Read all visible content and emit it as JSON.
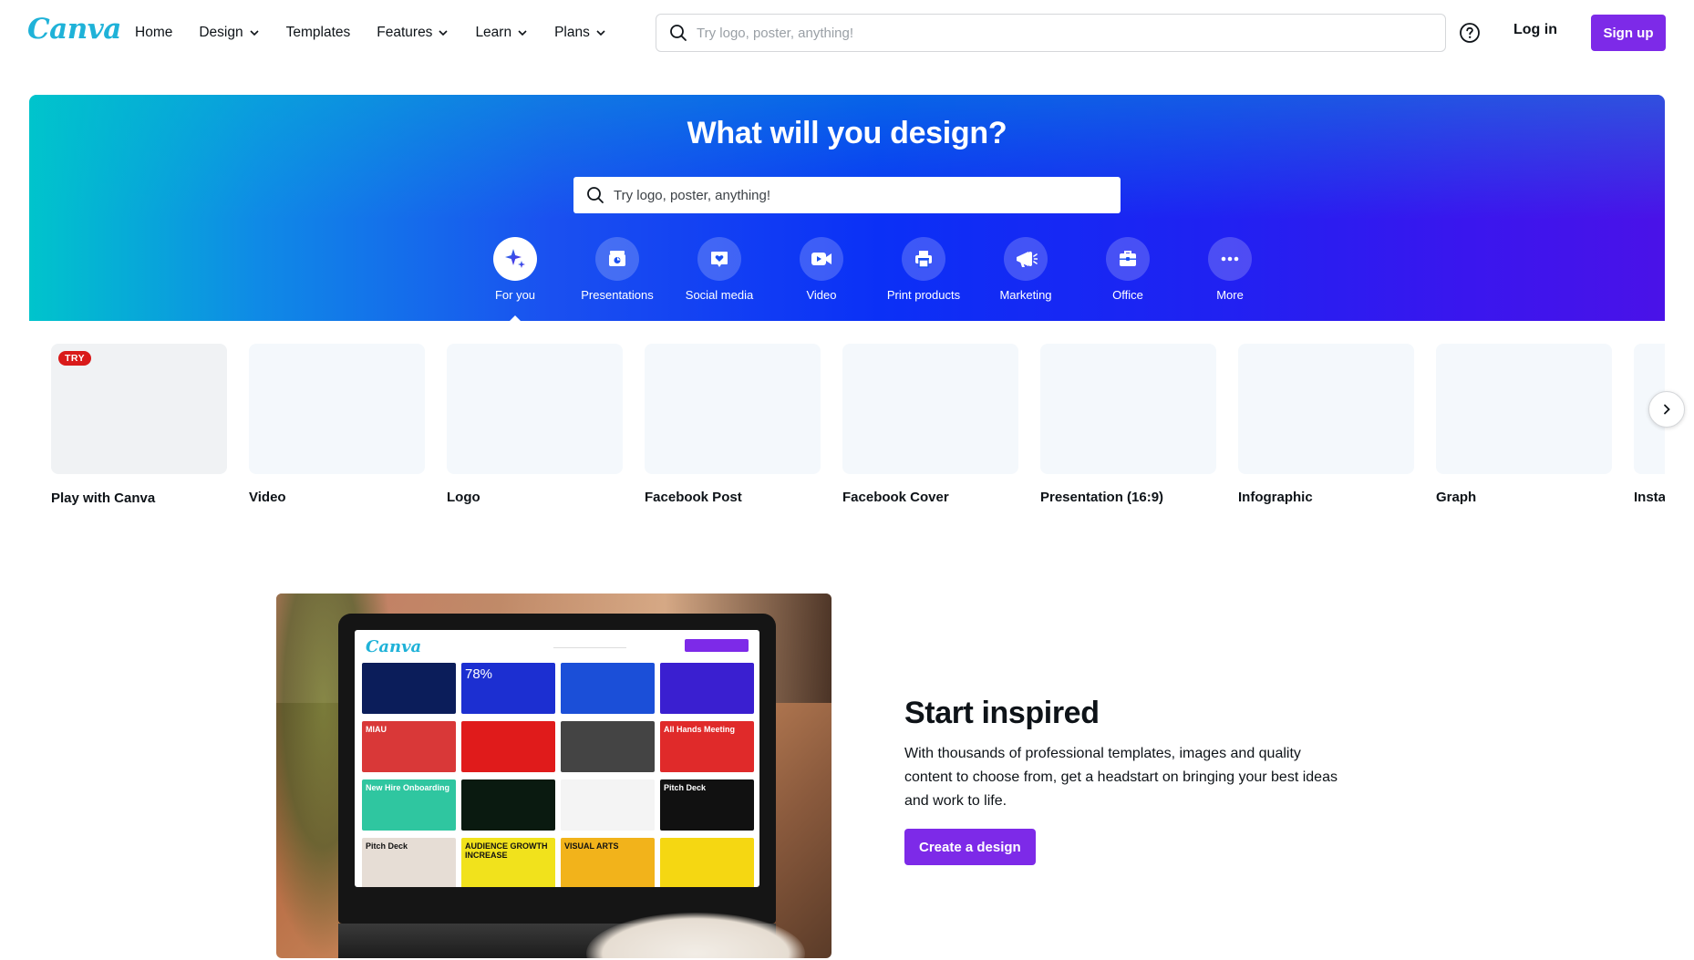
{
  "brand": {
    "logo_text": "Canva",
    "accent": "#7d2ae8",
    "logo_color": "#1fb2d8"
  },
  "nav": {
    "items": [
      {
        "label": "Home",
        "dropdown": false
      },
      {
        "label": "Design",
        "dropdown": true
      },
      {
        "label": "Templates",
        "dropdown": false
      },
      {
        "label": "Features",
        "dropdown": true
      },
      {
        "label": "Learn",
        "dropdown": true
      },
      {
        "label": "Plans",
        "dropdown": true
      }
    ],
    "search_placeholder": "Try logo, poster, anything!",
    "help_icon": "question-circle-icon",
    "login_label": "Log in",
    "signup_label": "Sign up"
  },
  "hero": {
    "title": "What will you design?",
    "search_placeholder": "Try logo, poster, anything!",
    "categories": [
      {
        "label": "For you",
        "icon": "sparkle-icon",
        "active": true
      },
      {
        "label": "Presentations",
        "icon": "presentation-icon",
        "active": false
      },
      {
        "label": "Social media",
        "icon": "heart-chat-icon",
        "active": false
      },
      {
        "label": "Video",
        "icon": "video-camera-icon",
        "active": false
      },
      {
        "label": "Print products",
        "icon": "printer-icon",
        "active": false
      },
      {
        "label": "Marketing",
        "icon": "megaphone-icon",
        "active": false
      },
      {
        "label": "Office",
        "icon": "briefcase-icon",
        "active": false
      },
      {
        "label": "More",
        "icon": "more-dots-icon",
        "active": false
      }
    ]
  },
  "design_types": [
    {
      "label": "Play with Canva",
      "badge": "TRY"
    },
    {
      "label": "Video"
    },
    {
      "label": "Logo"
    },
    {
      "label": "Facebook Post"
    },
    {
      "label": "Facebook Cover"
    },
    {
      "label": "Presentation (16:9)"
    },
    {
      "label": "Infographic"
    },
    {
      "label": "Graph"
    },
    {
      "label": "Instag"
    }
  ],
  "feature": {
    "title": "Start inspired",
    "body": "With thousands of professional templates, images and quality content to choose from, get a headstart on bringing your best ideas and work to life.",
    "button_label": "Create a design",
    "screen": {
      "logo": "Canva",
      "tiles": [
        {
          "text": "",
          "bg": "#0b1d5a"
        },
        {
          "text": "78%",
          "bg": "#1c2fd1"
        },
        {
          "text": "",
          "bg": "#1b4fd8"
        },
        {
          "text": "",
          "bg": "#3a1fd0"
        },
        {
          "text": "MIAU",
          "bg": "#d93838"
        },
        {
          "text": "",
          "bg": "#e01b1b"
        },
        {
          "text": "",
          "bg": "#444444"
        },
        {
          "text": "All Hands Meeting",
          "bg": "#e02a2a"
        },
        {
          "text": "New Hire Onboarding",
          "bg": "#2fc6a0"
        },
        {
          "text": "",
          "bg": "#0a1a10"
        },
        {
          "text": "",
          "bg": "#f4f4f4"
        },
        {
          "text": "Pitch Deck",
          "bg": "#111111"
        },
        {
          "text": "Pitch Deck",
          "bg": "#e6ddd5"
        },
        {
          "text": "AUDIENCE GROWTH INCREASE",
          "bg": "#f1e21c"
        },
        {
          "text": "VISUAL ARTS",
          "bg": "#f2b31b"
        },
        {
          "text": "",
          "bg": "#f5d712"
        }
      ]
    }
  }
}
